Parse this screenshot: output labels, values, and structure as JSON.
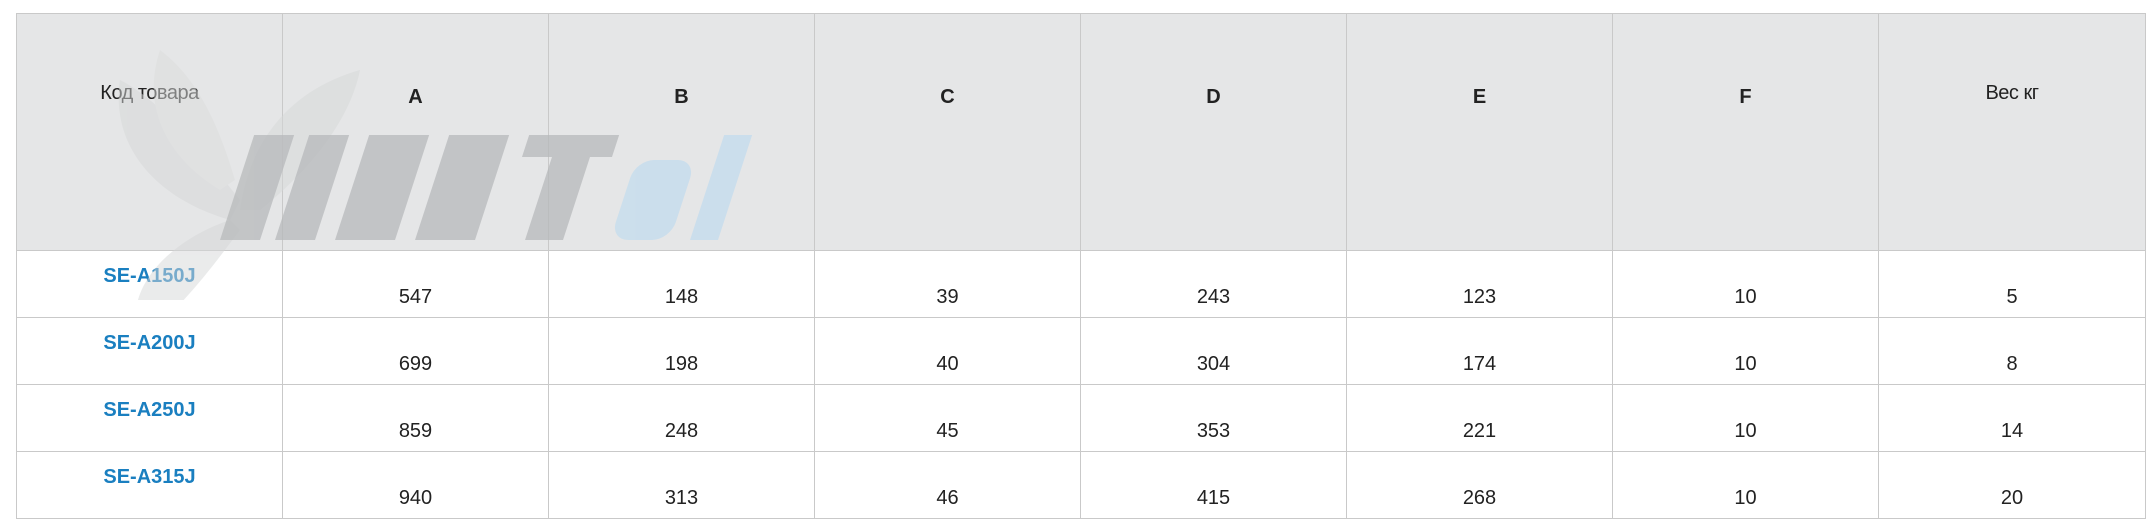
{
  "brand": {
    "watermark_logo": "vent-el-logo",
    "colors": {
      "grey": "#b6b8ba",
      "blue": "#c3dcee",
      "fan": "#d8d9da"
    }
  },
  "colors": {
    "header_bg": "#e5e6e7",
    "border": "#c9c9c9",
    "link": "#1a7fc0",
    "text": "#222222"
  },
  "table": {
    "headers": [
      "Код товара",
      "A",
      "B",
      "C",
      "D",
      "E",
      "F",
      "Вес кг"
    ],
    "rows": [
      {
        "code": "SE-A150J",
        "cells": [
          "547",
          "148",
          "39",
          "243",
          "123",
          "10",
          "5"
        ]
      },
      {
        "code": "SE-A200J",
        "cells": [
          "699",
          "198",
          "40",
          "304",
          "174",
          "10",
          "8"
        ]
      },
      {
        "code": "SE-A250J",
        "cells": [
          "859",
          "248",
          "45",
          "353",
          "221",
          "10",
          "14"
        ]
      },
      {
        "code": "SE-A315J",
        "cells": [
          "940",
          "313",
          "46",
          "415",
          "268",
          "10",
          "20"
        ]
      }
    ]
  }
}
